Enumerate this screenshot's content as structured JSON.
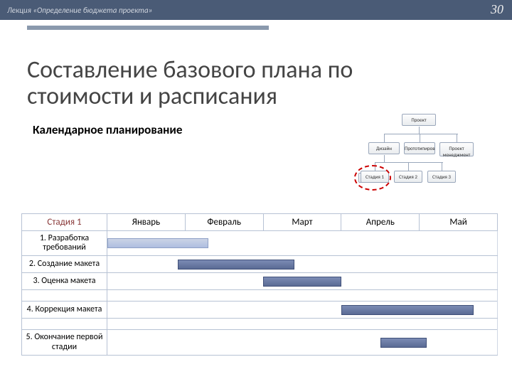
{
  "header": {
    "lecture": "Лекция «Определение бюджета проекта»",
    "page": "30"
  },
  "title": "Составление базового плана по стоимости и расписания",
  "subtitle": "Календарное планирование",
  "org": {
    "top": "Проект",
    "row2": {
      "a": "Дизайн",
      "b": "Прототипиров",
      "c": "Проект менеджмент"
    },
    "row3": {
      "s1": "Стадия 1",
      "s2": "Стадия 2",
      "s3": "Стадия 3"
    }
  },
  "gantt": {
    "stageHeader": "Стадия 1",
    "months": [
      "Январь",
      "Февраль",
      "Март",
      "Апрель",
      "Май"
    ],
    "rows": [
      {
        "label": "1. Разработка требований"
      },
      {
        "label": "2. Создание макета"
      },
      {
        "label": "3. Оценка макета"
      },
      {
        "label": "4. Коррекция макета"
      },
      {
        "label": "5. Окончание первой стадии"
      }
    ]
  },
  "chart_data": {
    "type": "gantt",
    "title": "Календарное планирование — Стадия 1",
    "x_categories": [
      "Январь",
      "Февраль",
      "Март",
      "Апрель",
      "Май"
    ],
    "tasks": [
      {
        "name": "1. Разработка требований",
        "start_month": 1,
        "end_month": 2.3,
        "style": "light"
      },
      {
        "name": "2. Создание макета",
        "start_month": 1.9,
        "end_month": 3.4,
        "style": "solid"
      },
      {
        "name": "3. Оценка макета",
        "start_month": 3.0,
        "end_month": 4.0,
        "style": "solid"
      },
      {
        "name": "4. Коррекция макета",
        "start_month": 4.0,
        "end_month": 5.7,
        "style": "solid"
      },
      {
        "name": "5. Окончание первой стадии",
        "start_month": 4.5,
        "end_month": 5.1,
        "style": "solid"
      }
    ]
  }
}
